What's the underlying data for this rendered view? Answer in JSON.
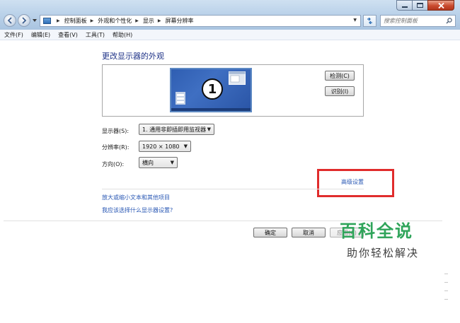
{
  "breadcrumb": {
    "items": [
      "控制面板",
      "外观和个性化",
      "显示",
      "屏幕分辨率"
    ]
  },
  "search": {
    "placeholder": "搜索控制面板"
  },
  "menu": {
    "items": [
      "文件(F)",
      "编辑(E)",
      "查看(V)",
      "工具(T)",
      "帮助(H)"
    ]
  },
  "main": {
    "title": "更改显示器的外观",
    "monitor_number": "1",
    "detect_label": "检测(C)",
    "identify_label": "识别(I)",
    "display_label": "显示器(S):",
    "display_value": "1. 通用非即插即用监视器",
    "resolution_label": "分辨率(R):",
    "resolution_value": "1920 × 1080",
    "orientation_label": "方向(O):",
    "orientation_value": "横向",
    "advanced_link": "高级设置",
    "link_text_size": "放大或缩小文本和其他项目",
    "link_which_settings": "我应该选择什么显示器设置?"
  },
  "footer": {
    "ok_label": "确定",
    "cancel_label": "取消",
    "apply_label": "应用(A)"
  },
  "watermark": {
    "main": "百科全说",
    "sub": "助你轻松解决"
  },
  "colors": {
    "title_blue": "#1e3287",
    "link_blue": "#2a58b4",
    "highlight_red": "#e02c2c",
    "watermark_green": "#2fa45a"
  }
}
